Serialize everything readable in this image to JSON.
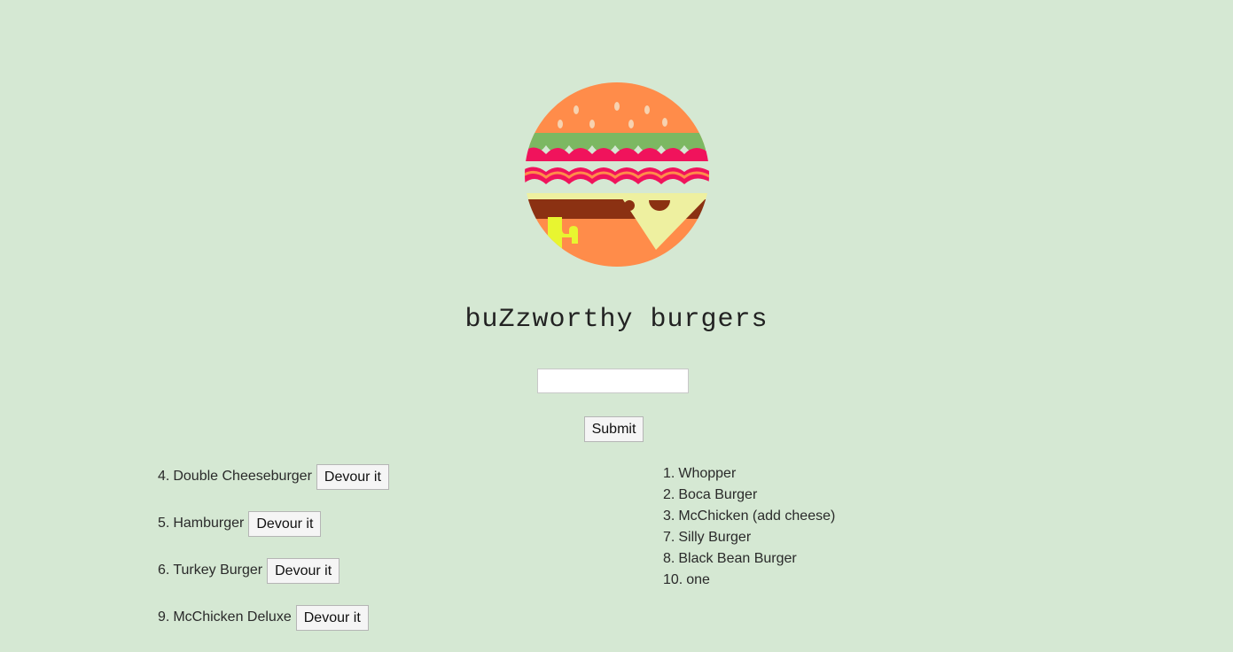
{
  "logo": {
    "name": "burger-logo"
  },
  "title": "buZzworthy burgers",
  "form": {
    "input_value": "",
    "placeholder": "",
    "submit_label": "Submit"
  },
  "uneaten_burgers": [
    {
      "number": "4.",
      "name": "Double Cheeseburger",
      "button_label": "Devour it"
    },
    {
      "number": "5.",
      "name": "Hamburger",
      "button_label": "Devour it"
    },
    {
      "number": "6.",
      "name": "Turkey Burger",
      "button_label": "Devour it"
    },
    {
      "number": "9.",
      "name": "McChicken Deluxe",
      "button_label": "Devour it"
    }
  ],
  "devoured_burgers": [
    {
      "number": "1.",
      "name": "Whopper"
    },
    {
      "number": "2.",
      "name": "Boca Burger"
    },
    {
      "number": "3.",
      "name": "McChicken (add cheese)"
    },
    {
      "number": "7.",
      "name": "Silly Burger"
    },
    {
      "number": "8.",
      "name": "Black Bean Burger"
    },
    {
      "number": "10.",
      "name": "one"
    }
  ],
  "colors": {
    "background": "#d5e8d3",
    "bun": "#ff8c4a",
    "lettuce": "#7cb862",
    "tomato": "#f0135c",
    "cheese": "#eef0a0",
    "patty": "#8b3112",
    "drip": "#e8f530"
  }
}
